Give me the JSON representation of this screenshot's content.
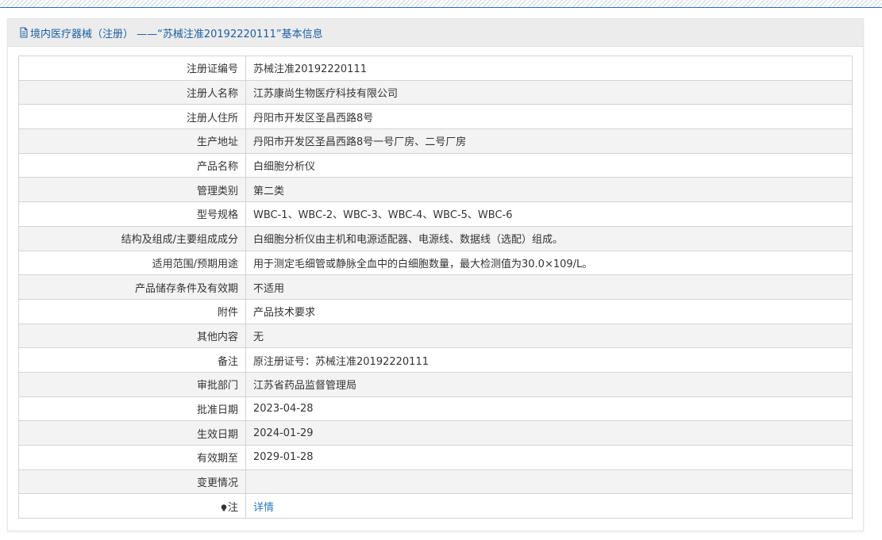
{
  "header": {
    "title": "境内医疗器械（注册） ——“苏械注准20192220111”基本信息"
  },
  "rows": [
    {
      "label": "注册证编号",
      "value": "苏械注准20192220111"
    },
    {
      "label": "注册人名称",
      "value": "江苏康尚生物医疗科技有限公司"
    },
    {
      "label": "注册人住所",
      "value": "丹阳市开发区圣昌西路8号"
    },
    {
      "label": "生产地址",
      "value": "丹阳市开发区圣昌西路8号一号厂房、二号厂房"
    },
    {
      "label": "产品名称",
      "value": "白细胞分析仪"
    },
    {
      "label": "管理类别",
      "value": "第二类"
    },
    {
      "label": "型号规格",
      "value": "WBC-1、WBC-2、WBC-3、WBC-4、WBC-5、WBC-6"
    },
    {
      "label": "结构及组成/主要组成成分",
      "value": "白细胞分析仪由主机和电源适配器、电源线、数据线（选配）组成。"
    },
    {
      "label": "适用范围/预期用途",
      "value": "用于测定毛细管或静脉全血中的白细胞数量，最大检测值为30.0×109/L。"
    },
    {
      "label": "产品储存条件及有效期",
      "value": "不适用"
    },
    {
      "label": "附件",
      "value": "产品技术要求"
    },
    {
      "label": "其他内容",
      "value": "无"
    },
    {
      "label": "备注",
      "value": "原注册证号：苏械注准20192220111"
    },
    {
      "label": "审批部门",
      "value": "江苏省药品监督管理局"
    },
    {
      "label": "批准日期",
      "value": "2023-04-28"
    },
    {
      "label": "生效日期",
      "value": "2024-01-29"
    },
    {
      "label": "有效期至",
      "value": "2029-01-28"
    },
    {
      "label": "变更情况",
      "value": ""
    }
  ],
  "note_row": {
    "label": "注",
    "icon": "bulb-icon",
    "link_text": "详情"
  },
  "colors": {
    "accent": "#1a5fa3",
    "link": "#2c7bc3",
    "header_bg": "#ececec",
    "row_alt": "#f3f3f3"
  }
}
